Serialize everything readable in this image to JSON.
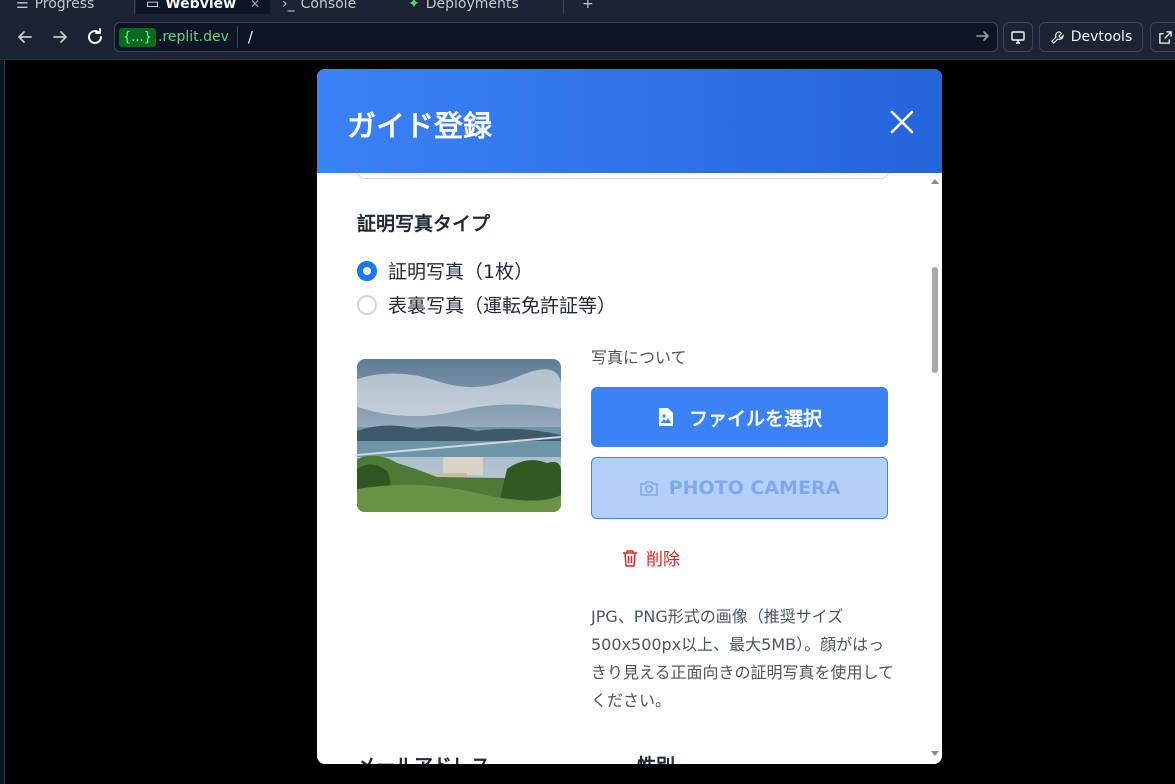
{
  "browser": {
    "tabs": [
      {
        "label": "Progress",
        "icon": "progress-icon"
      },
      {
        "label": "Webview",
        "icon": "monitor-icon"
      },
      {
        "label": "Console",
        "icon": "terminal-icon"
      },
      {
        "label": "Deployments",
        "icon": "deploy-icon"
      }
    ],
    "url_badge": "{...}",
    "url_domain": ".replit.dev",
    "url_path": "/",
    "devtools_label": "Devtools"
  },
  "modal": {
    "title": "ガイド登録",
    "photo_type_label": "証明写真タイプ",
    "radio_options": [
      {
        "label": "証明写真（1枚）",
        "selected": true
      },
      {
        "label": "表裏写真（運転免許証等）",
        "selected": false
      }
    ],
    "photo_about_label": "写真について",
    "file_button_label": "ファイルを選択",
    "camera_button_label": "PHOTO CAMERA",
    "delete_button_label": "削除",
    "note_text": "JPG、PNG形式の画像（推奨サイズ500x500px以上、最大5MB）。顔がはっきり見える正面向きの証明写真を使用してください。",
    "next_field_labels": [
      "メールアドレス",
      "性別"
    ]
  },
  "colors": {
    "header_gradient_start": "#3b82f6",
    "header_gradient_end": "#2563d9",
    "primary_button": "#3b82f6",
    "disabled_button": "#b3d0fb",
    "danger": "#dc2626",
    "radio_selected": "#1877f2"
  }
}
